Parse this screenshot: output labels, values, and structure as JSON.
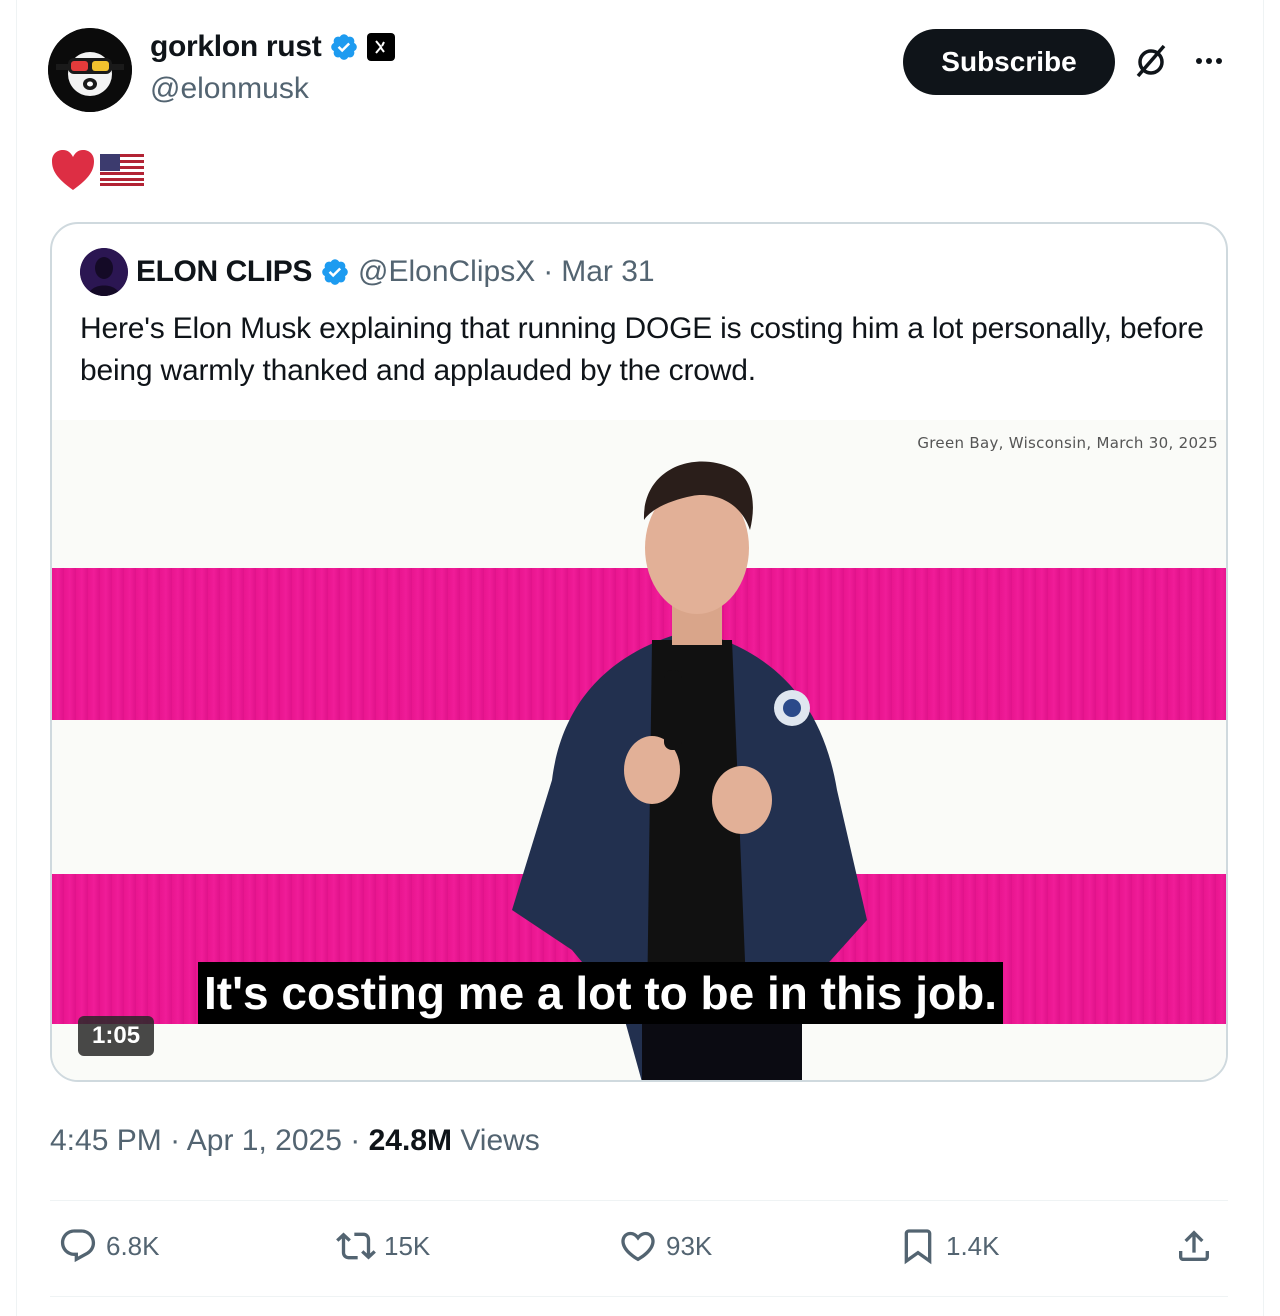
{
  "author": {
    "display_name": "gorklon rust",
    "handle": "@elonmusk"
  },
  "header": {
    "subscribe_label": "Subscribe"
  },
  "post": {
    "text_emojis": [
      "red-heart",
      "us-flag"
    ]
  },
  "quote": {
    "name": "ELON CLIPS",
    "handle": "@ElonClipsX",
    "separator": "·",
    "date": "Mar 31",
    "text": "Here's Elon Musk explaining that running DOGE is costing him a lot personally, before being warmly thanked and applauded by the crowd.",
    "video": {
      "location_text": "Green Bay, Wisconsin, March 30, 2025",
      "caption": "It's costing me a lot to be in this job.",
      "duration": "1:05"
    }
  },
  "meta": {
    "time": "4:45 PM",
    "sep1": "·",
    "date": "Apr 1, 2025",
    "sep2": "·",
    "views_count": "24.8M",
    "views_label": "Views"
  },
  "actions": {
    "replies": "6.8K",
    "reposts": "15K",
    "likes": "93K",
    "bookmarks": "1.4K"
  },
  "colors": {
    "verified_blue": "#1d9bf0",
    "text_primary": "#0f1419",
    "text_secondary": "#536471",
    "stripe_pink": "#e9158f"
  }
}
